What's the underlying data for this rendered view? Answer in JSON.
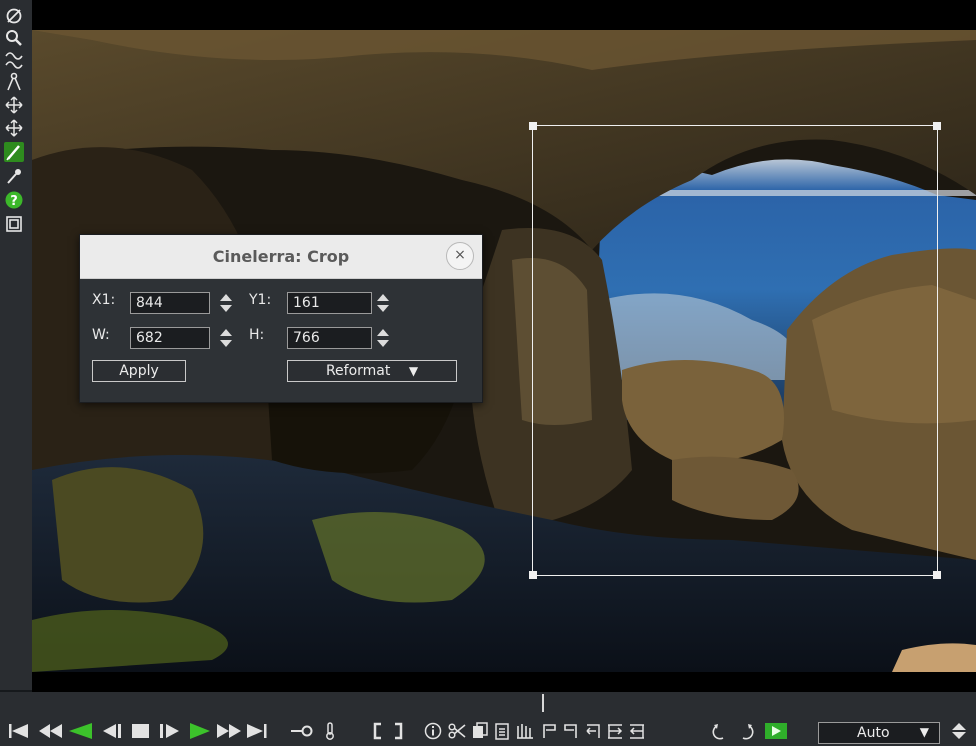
{
  "dialog": {
    "title": "Cinelerra: Crop",
    "close_glyph": "×",
    "x1_label": "X1:",
    "x1_value": "844",
    "y1_label": "Y1:",
    "y1_value": "161",
    "w_label": "W:",
    "w_value": "682",
    "h_label": "H:",
    "h_value": "766",
    "apply_label": "Apply",
    "reformat_label": "Reformat",
    "reformat_arrow": "▼"
  },
  "toolbar": {
    "icons": [
      "disable-icon",
      "zoom-icon",
      "curve-icon",
      "ruler-icon",
      "move-icon",
      "pan-icon",
      "crop-icon",
      "eyedropper-icon",
      "help-icon",
      "safe-region-icon"
    ]
  },
  "transport": {
    "zoom_value": "Auto",
    "zoom_arrow": "▼"
  },
  "colors": {
    "accent": "#2e8b1e",
    "play_green": "#3cc22b",
    "dialog_bg": "#2e3236"
  }
}
